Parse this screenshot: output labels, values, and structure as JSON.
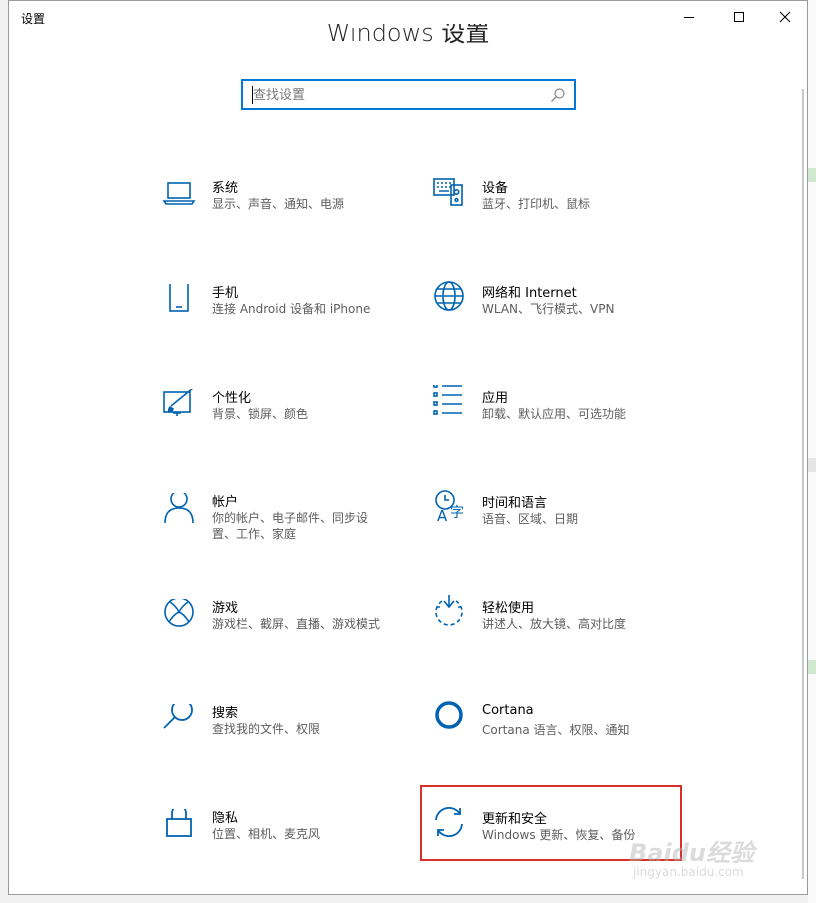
{
  "window": {
    "title": "设置",
    "heading": "Windows 设置",
    "controls": {
      "minimize": "minimize-icon",
      "maximize": "maximize-icon",
      "close": "close-icon"
    }
  },
  "search": {
    "placeholder": "查找设置",
    "value": "",
    "icon": "search-icon"
  },
  "colors": {
    "accent": "#0078d7",
    "highlight": "#d9302c"
  },
  "categories": [
    {
      "title": "系统",
      "desc": "显示、声音、通知、电源",
      "icon": "laptop-icon"
    },
    {
      "title": "设备",
      "desc": "蓝牙、打印机、鼠标",
      "icon": "keyboard-icon"
    },
    {
      "title": "手机",
      "desc": "连接 Android 设备和 iPhone",
      "icon": "phone-icon"
    },
    {
      "title": "网络和 Internet",
      "desc": "WLAN、飞行模式、VPN",
      "icon": "globe-icon"
    },
    {
      "title": "个性化",
      "desc": "背景、锁屏、颜色",
      "icon": "paint-icon"
    },
    {
      "title": "应用",
      "desc": "卸载、默认应用、可选功能",
      "icon": "apps-list-icon"
    },
    {
      "title": "帐户",
      "desc": "你的帐户、电子邮件、同步设置、工作、家庭",
      "icon": "person-icon"
    },
    {
      "title": "时间和语言",
      "desc": "语音、区域、日期",
      "icon": "time-language-icon"
    },
    {
      "title": "游戏",
      "desc": "游戏栏、截屏、直播、游戏模式",
      "icon": "xbox-icon"
    },
    {
      "title": "轻松使用",
      "desc": "讲述人、放大镜、高对比度",
      "icon": "ease-of-access-icon"
    },
    {
      "title": "搜索",
      "desc": "查找我的文件、权限",
      "icon": "magnifier-icon"
    },
    {
      "title": "Cortana",
      "desc": "Cortana 语言、权限、通知",
      "icon": "cortana-ring-icon"
    },
    {
      "title": "隐私",
      "desc": "位置、相机、麦克风",
      "icon": "lock-icon"
    },
    {
      "title": "更新和安全",
      "desc": "Windows 更新、恢复、备份",
      "icon": "update-sync-icon"
    }
  ],
  "watermark": {
    "brand": "Baidu经验",
    "url": "jingyan.baidu.com"
  }
}
